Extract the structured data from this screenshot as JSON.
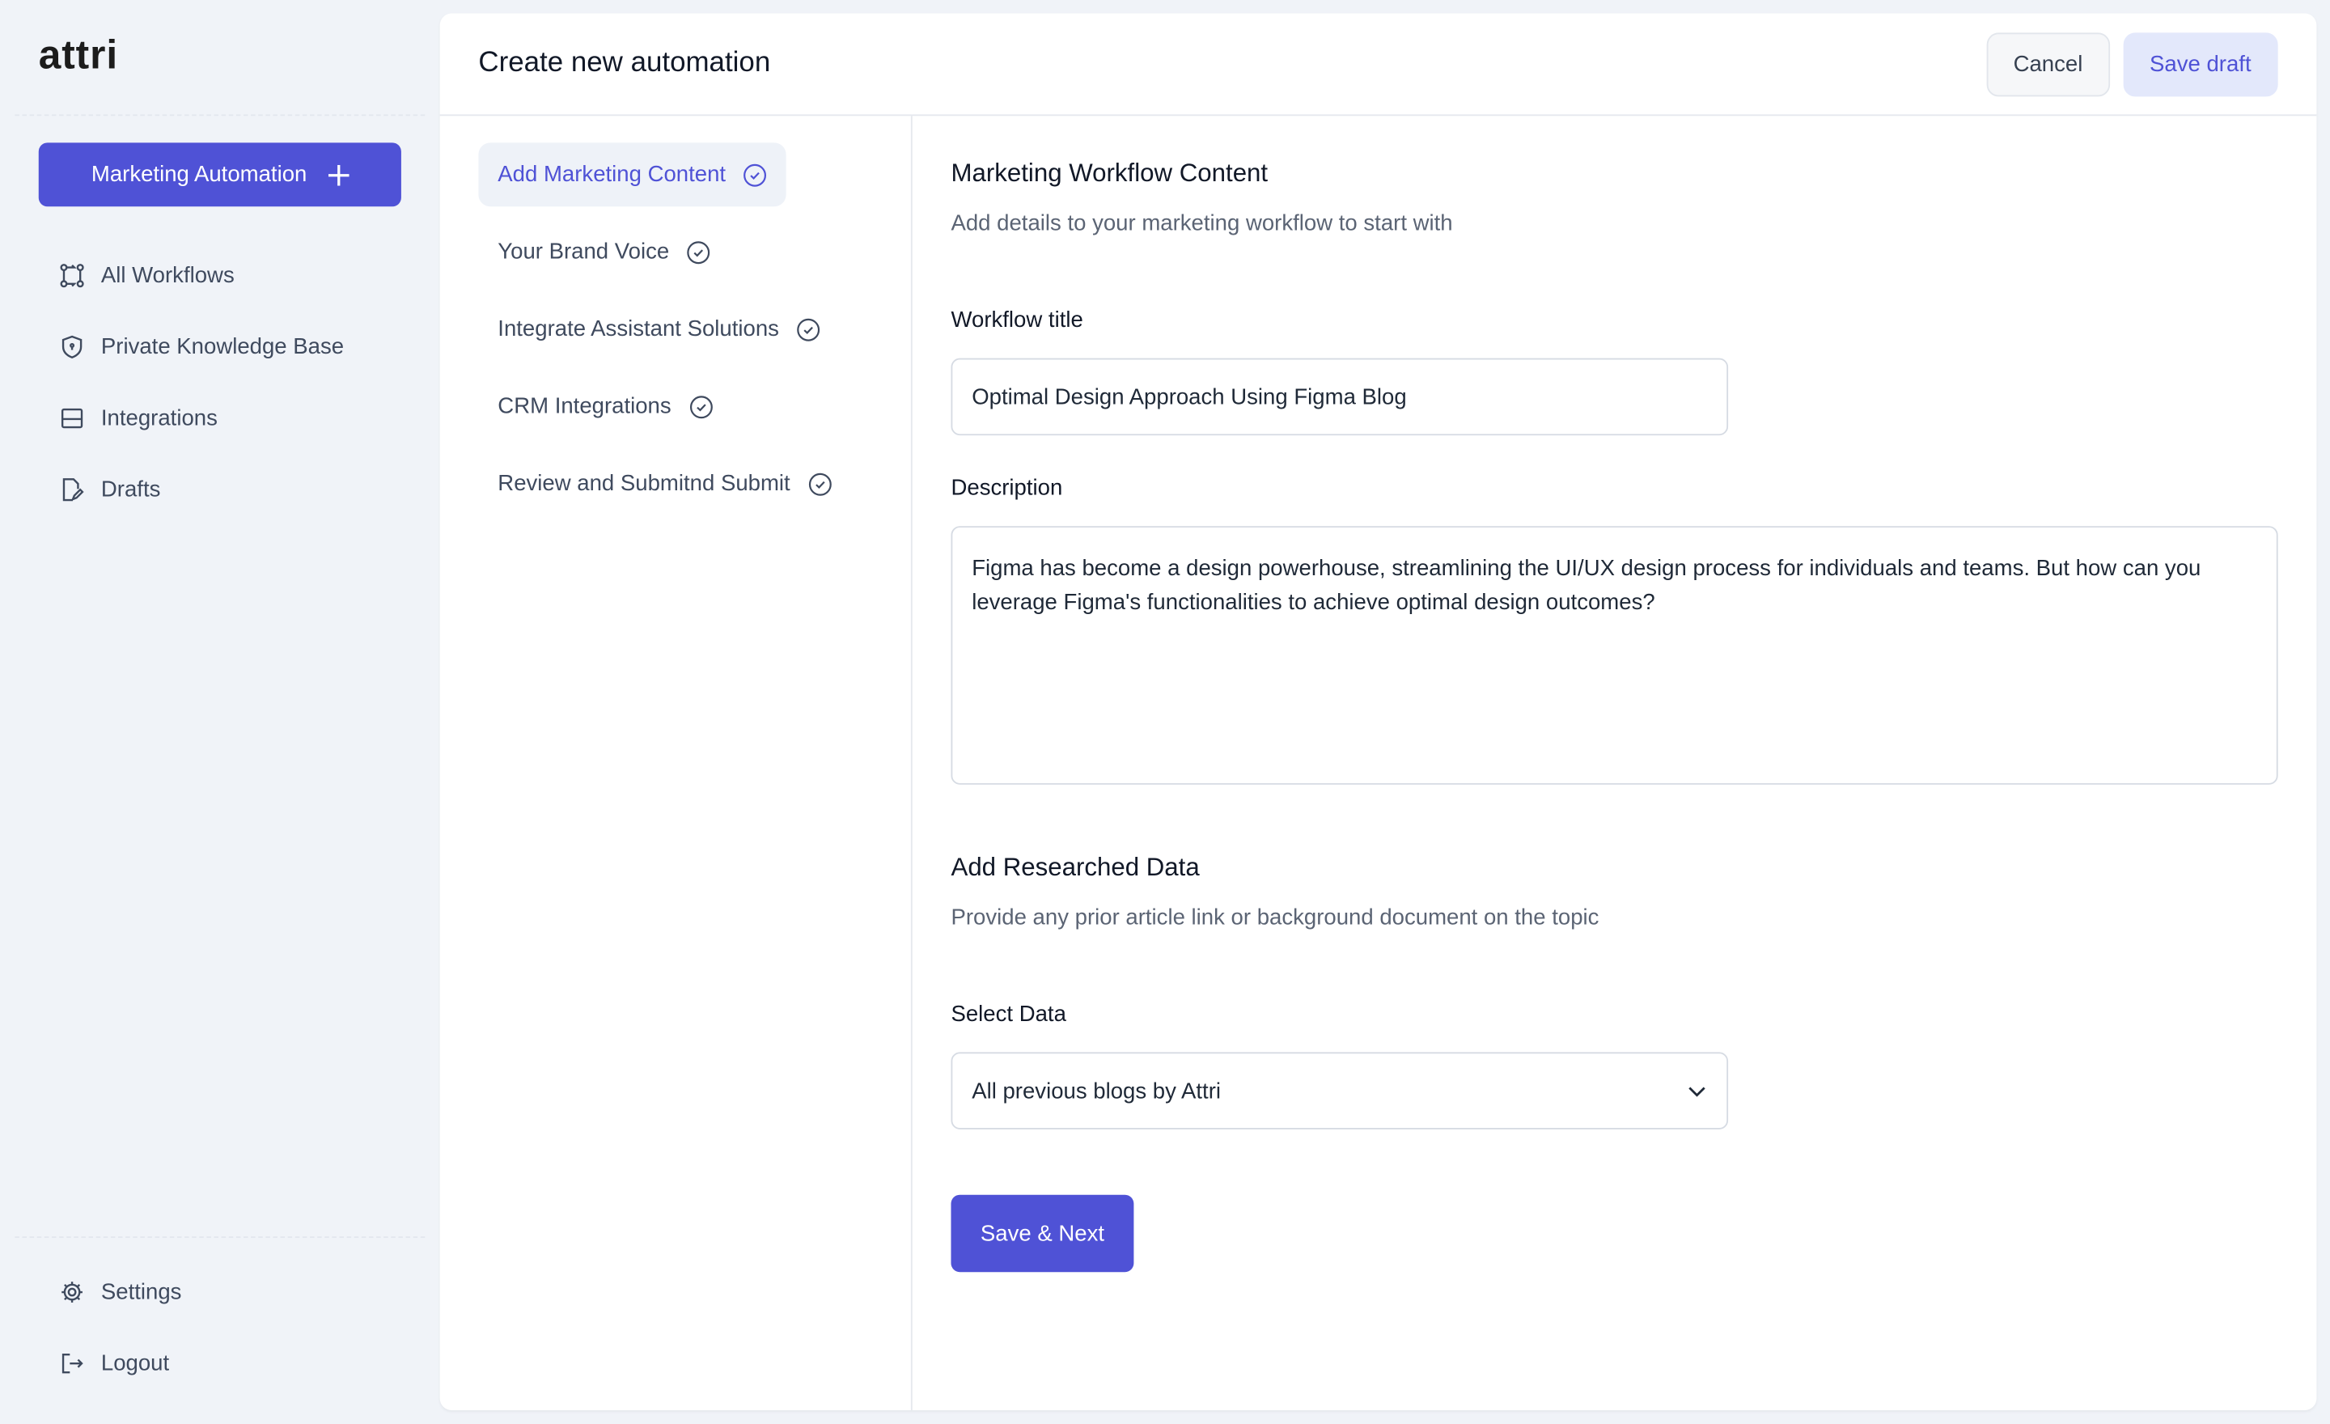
{
  "sidebar": {
    "logo": "attri",
    "primary_button": "Marketing Automation",
    "items": [
      {
        "label": "All Workflows",
        "icon": "workflow-icon"
      },
      {
        "label": "Private Knowledge Base",
        "icon": "shield-icon"
      },
      {
        "label": "Integrations",
        "icon": "integrations-icon"
      },
      {
        "label": "Drafts",
        "icon": "drafts-icon"
      }
    ],
    "bottom": [
      {
        "label": "Settings",
        "icon": "gear-icon"
      },
      {
        "label": "Logout",
        "icon": "logout-icon"
      }
    ]
  },
  "header": {
    "title": "Create new automation",
    "cancel": "Cancel",
    "save_draft": "Save draft"
  },
  "steps": [
    {
      "label": "Add Marketing Content",
      "active": true
    },
    {
      "label": "Your Brand Voice"
    },
    {
      "label": "Integrate Assistant Solutions"
    },
    {
      "label": "CRM Integrations"
    },
    {
      "label": "Review and Submitnd Submit"
    }
  ],
  "form": {
    "section1_title": "Marketing Workflow Content",
    "section1_sub": "Add details to your marketing workflow to start with",
    "workflow_title_label": "Workflow title",
    "workflow_title_value": "Optimal Design Approach Using Figma Blog",
    "description_label": "Description",
    "description_value": "Figma has become a design powerhouse, streamlining the UI/UX design process for individuals and teams. But how can you leverage Figma's functionalities to achieve optimal design outcomes?",
    "section2_title": "Add Researched Data",
    "section2_sub": "Provide any prior article link or background document on the topic",
    "select_label": "Select Data",
    "select_value": "All previous blogs by Attri",
    "save_next": "Save & Next"
  },
  "colors": {
    "accent": "#4f52d6",
    "background": "#f0f3f8"
  }
}
